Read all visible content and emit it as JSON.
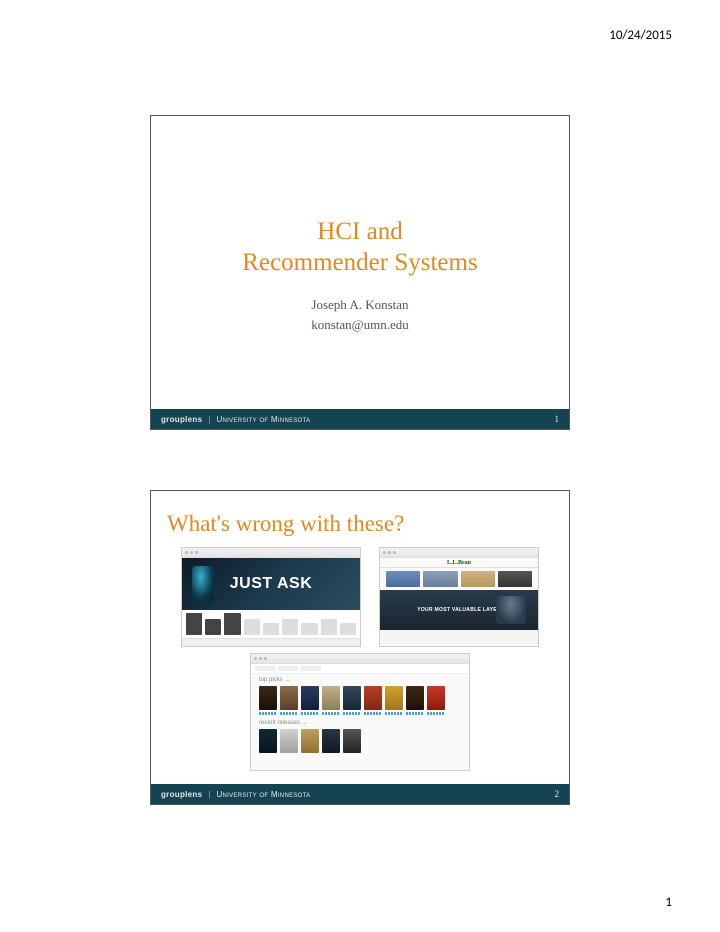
{
  "page": {
    "date": "10/24/2015",
    "number": "1"
  },
  "slide1": {
    "title_line1": "HCI and",
    "title_line2": "Recommender Systems",
    "author": "Joseph A. Konstan",
    "email": "konstan@umn.edu",
    "footer_brand": "grouplens",
    "footer_univ": "University of Minnesota",
    "footer_num": "1"
  },
  "slide2": {
    "title": "What's wrong with these?",
    "amazon_hero": "JUST ASK",
    "llbean_logo": "L.L.Bean",
    "llbean_hero": "YOUR MOST VALUABLE LAYER",
    "ml_section1": "top picks",
    "ml_section2": "recent releases",
    "footer_brand": "grouplens",
    "footer_univ": "University of Minnesota",
    "footer_num": "2"
  }
}
